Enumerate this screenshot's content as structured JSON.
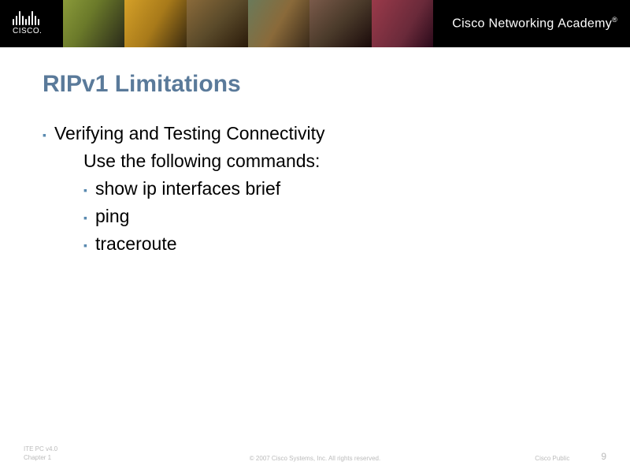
{
  "header": {
    "logo_text": "CISCO.",
    "academy_prefix": "Cisco ",
    "academy_mid": "Networking ",
    "academy_suffix": "Academy",
    "academy_mark": "®"
  },
  "slide": {
    "title": "RIPv1 Limitations",
    "main_bullet": "Verifying and Testing Connectivity",
    "sub_text": "Use the following commands:",
    "commands": [
      "show ip interfaces brief",
      "ping",
      "traceroute"
    ]
  },
  "footer": {
    "left_line1": "ITE PC v4.0",
    "left_line2": "Chapter 1",
    "center": "© 2007 Cisco Systems, Inc. All rights reserved.",
    "right_label": "Cisco Public",
    "page": "9"
  }
}
